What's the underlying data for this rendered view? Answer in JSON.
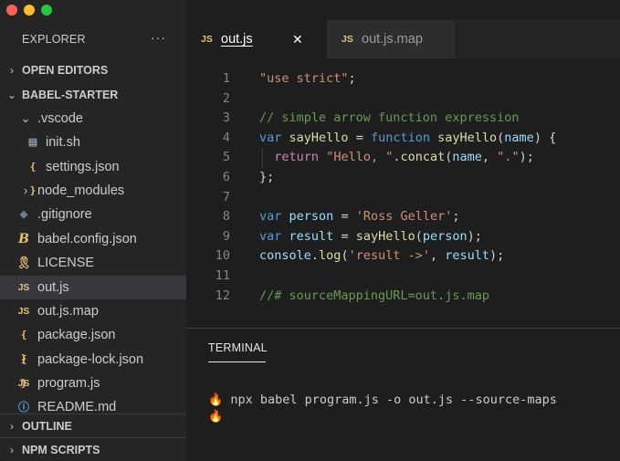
{
  "explorer": {
    "title": "EXPLORER",
    "more": "···",
    "open_editors": "OPEN EDITORS",
    "project": "BABEL-STARTER",
    "outline": "OUTLINE",
    "npm_scripts": "NPM SCRIPTS",
    "items": [
      {
        "label": ".vscode",
        "icon": "chevron-down-icon",
        "active": false
      },
      {
        "label": "init.sh",
        "icon": "shell-file-icon",
        "active": false
      },
      {
        "label": "settings.json",
        "icon": "json-file-icon",
        "active": false
      },
      {
        "label": "node_modules",
        "icon": "chevron-right-icon",
        "active": false
      },
      {
        "label": ".gitignore",
        "icon": "git-file-icon",
        "active": false
      },
      {
        "label": "babel.config.json",
        "icon": "babel-file-icon",
        "active": false
      },
      {
        "label": "LICENSE",
        "icon": "license-file-icon",
        "active": false
      },
      {
        "label": "out.js",
        "icon": "js-file-icon",
        "active": true
      },
      {
        "label": "out.js.map",
        "icon": "js-file-icon",
        "active": false
      },
      {
        "label": "package.json",
        "icon": "json-file-icon",
        "active": false
      },
      {
        "label": "package-lock.json",
        "icon": "json-file-icon",
        "active": false
      },
      {
        "label": "program.js",
        "icon": "js-file-icon",
        "active": false
      },
      {
        "label": "README.md",
        "icon": "info-file-icon",
        "active": false
      }
    ]
  },
  "icons": {
    "js": "JS",
    "json": "{ }",
    "shell": "▤",
    "git": "◆",
    "babel": "B",
    "license": "🎗",
    "info": "ⓘ",
    "chev_down": "⌄",
    "chev_right": "›",
    "close": "✕",
    "fire": "🔥"
  },
  "tabs": [
    {
      "label": "out.js",
      "badge": "JS",
      "active": true
    },
    {
      "label": "out.js.map",
      "badge": "JS",
      "active": false
    }
  ],
  "editor": {
    "lines": [
      {
        "n": "1",
        "tokens": [
          [
            "str",
            "\"use strict\""
          ],
          [
            "pl",
            ";"
          ]
        ]
      },
      {
        "n": "2",
        "tokens": []
      },
      {
        "n": "3",
        "tokens": [
          [
            "com",
            "// simple arrow function expression"
          ]
        ]
      },
      {
        "n": "4",
        "tokens": [
          [
            "kw",
            "var"
          ],
          [
            "pl",
            " "
          ],
          [
            "fn",
            "sayHello"
          ],
          [
            "pl",
            " = "
          ],
          [
            "kw",
            "function"
          ],
          [
            "pl",
            " "
          ],
          [
            "fn",
            "sayHello"
          ],
          [
            "pl",
            "("
          ],
          [
            "var",
            "name"
          ],
          [
            "pl",
            ") {"
          ]
        ]
      },
      {
        "n": "5",
        "tokens": [
          [
            "pl",
            "  "
          ],
          [
            "ctl",
            "return"
          ],
          [
            "pl",
            " "
          ],
          [
            "str",
            "\"Hello, \""
          ],
          [
            "pl",
            "."
          ],
          [
            "fn",
            "concat"
          ],
          [
            "pl",
            "("
          ],
          [
            "var",
            "name"
          ],
          [
            "pl",
            ", "
          ],
          [
            "str",
            "\".\""
          ],
          [
            "pl",
            ");"
          ]
        ],
        "guide": true
      },
      {
        "n": "6",
        "tokens": [
          [
            "pl",
            "};"
          ]
        ]
      },
      {
        "n": "7",
        "tokens": []
      },
      {
        "n": "8",
        "tokens": [
          [
            "kw",
            "var"
          ],
          [
            "pl",
            " "
          ],
          [
            "var",
            "person"
          ],
          [
            "pl",
            " = "
          ],
          [
            "str",
            "'Ross Geller'"
          ],
          [
            "pl",
            ";"
          ]
        ]
      },
      {
        "n": "9",
        "tokens": [
          [
            "kw",
            "var"
          ],
          [
            "pl",
            " "
          ],
          [
            "var",
            "result"
          ],
          [
            "pl",
            " = "
          ],
          [
            "fn",
            "sayHello"
          ],
          [
            "pl",
            "("
          ],
          [
            "var",
            "person"
          ],
          [
            "pl",
            ");"
          ]
        ]
      },
      {
        "n": "10",
        "tokens": [
          [
            "var",
            "console"
          ],
          [
            "pl",
            "."
          ],
          [
            "fn",
            "log"
          ],
          [
            "pl",
            "("
          ],
          [
            "str",
            "'result ->'"
          ],
          [
            "pl",
            ", "
          ],
          [
            "var",
            "result"
          ],
          [
            "pl",
            ");"
          ]
        ]
      },
      {
        "n": "11",
        "tokens": []
      },
      {
        "n": "12",
        "tokens": [
          [
            "com",
            "//# sourceMappingURL=out.js.map"
          ]
        ]
      }
    ]
  },
  "terminal": {
    "tab_label": "TERMINAL",
    "lines": [
      {
        "prompt": "🔥",
        "text": " npx babel program.js -o out.js --source-maps"
      },
      {
        "prompt": "🔥",
        "text": ""
      }
    ]
  }
}
